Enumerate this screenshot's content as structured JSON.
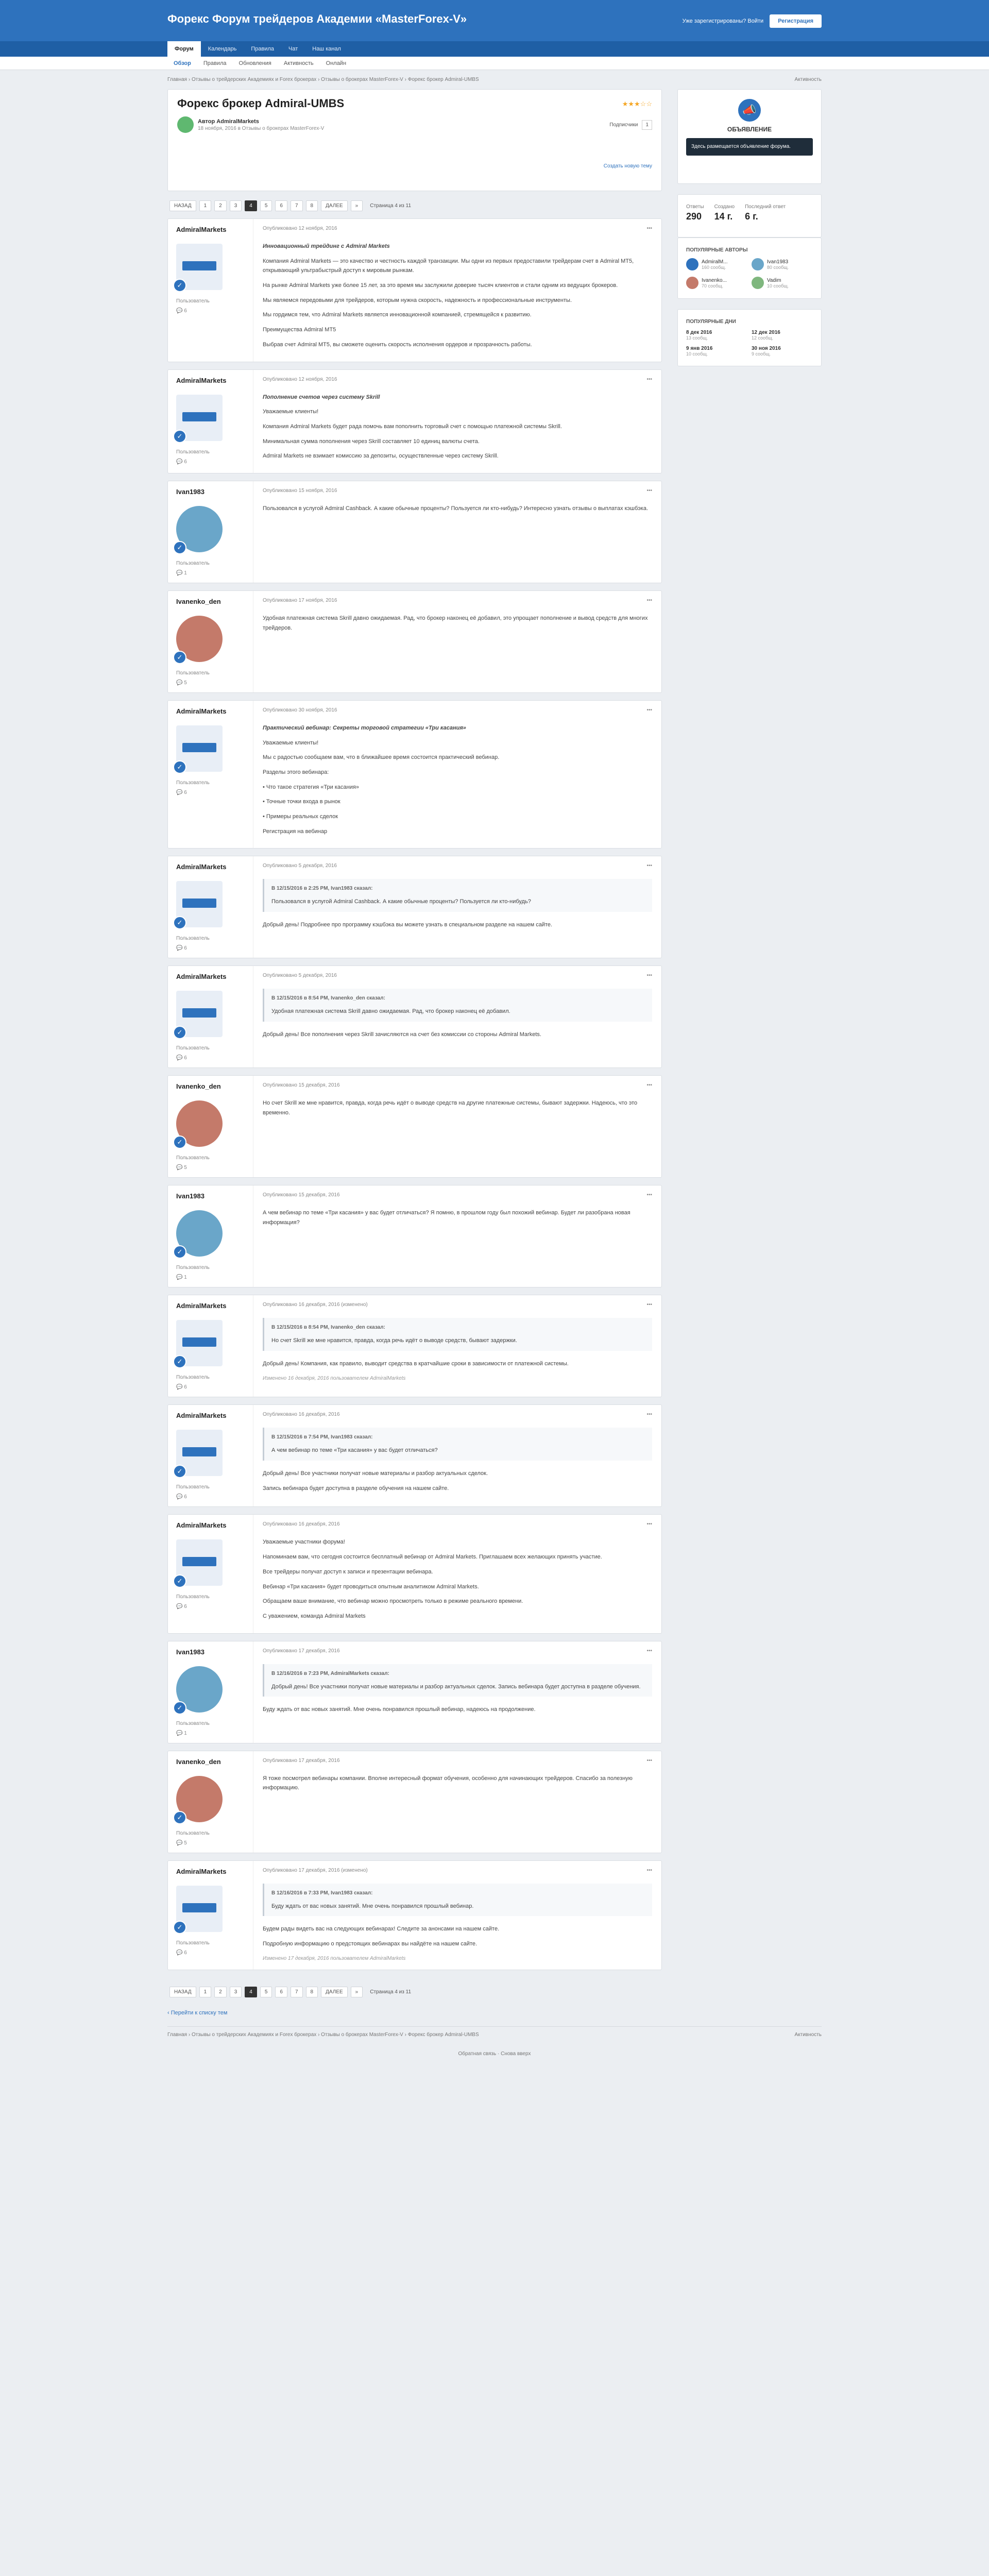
{
  "header": {
    "logo": "Форекс Форум трейдеров Академии «MasterForex-V»",
    "have_account": "Уже зарегистрированы? Войти",
    "register": "Регистрация",
    "nav": [
      "Форум",
      "Календарь",
      "Правила",
      "Чат",
      "Наш канал"
    ],
    "subnav": [
      "Обзор",
      "Правила",
      "Обновления",
      "Активность",
      "Онлайн"
    ]
  },
  "crumbs": {
    "path": "Главная › Отзывы о трейдерских Академиях и Forex брокерах › Отзывы о брокерах MasterForex-V › Форекс брокер Admiral-UMBS",
    "activity": "Активность"
  },
  "topic": {
    "title": "Форекс брокер Admiral-UMBS",
    "rating": "★★★☆☆",
    "author": "Автор AdmiralMarkets",
    "date": "18 ноября, 2016 в Отзывы о брокерах MasterForex-V",
    "subscribe_label": "Подписчики",
    "subscribe_count": "1",
    "create_new": "Создать новую тему"
  },
  "pager": {
    "prev": "НАЗАД",
    "pages": [
      "1",
      "2",
      "3",
      "4",
      "5",
      "6",
      "7",
      "8"
    ],
    "current": "4",
    "next": "ДАЛЕЕ",
    "last": "»",
    "info": "Страница 4 из 11"
  },
  "posts": [
    {
      "name": "AdmiralMarkets",
      "role": "Пользователь",
      "count": "6",
      "date": "Опубликовано 12 ноября, 2016",
      "paras": [
        "Инновационный трейдинг с Admiral Markets",
        "Компания Admiral Markets — это качество и честность каждой транзакции. Мы одни из первых предоставили трейдерам счет в Admiral MT5, открывающий ультрабыстрый доступ к мировым рынкам.",
        "На рынке Admiral Markets уже более 15 лет, за это время мы заслужили доверие тысяч клиентов и стали одним из ведущих брокеров.",
        "Мы являемся передовыми для трейдеров, которым нужна скорость, надежность и профессиональные инструменты.",
        "Мы гордимся тем, что Admiral Markets является инновационной компанией, стремящейся к развитию.",
        "Преимущества Admiral MT5",
        "Выбрав счет Admiral MT5, вы сможете оценить скорость исполнения ордеров и прозрачность работы."
      ]
    },
    {
      "name": "AdmiralMarkets",
      "role": "Пользователь",
      "count": "6",
      "date": "Опубликовано 12 ноября, 2016",
      "paras": [
        "Пополнение счетов через систему Skrill",
        "Уважаемые клиенты!",
        "Компания Admiral Markets будет рада помочь вам пополнить торговый счет с помощью платежной системы Skrill.",
        "Минимальная сумма пополнения через Skrill составляет 10 единиц валюты счета.",
        "Admiral Markets не взимает комиссию за депозиты, осуществленные через систему Skrill."
      ]
    },
    {
      "name": "Ivan1983",
      "role": "Пользователь",
      "count": "1",
      "date": "Опубликовано 15 ноября, 2016",
      "paras": [
        "Пользовался в услугой Admiral Cashback. А какие обычные проценты? Пользуется ли кто-нибудь? Интересно узнать отзывы о выплатах кэшбэка."
      ]
    },
    {
      "name": "Ivanenko_den",
      "role": "Пользователь",
      "count": "5",
      "date": "Опубликовано 17 ноября, 2016",
      "paras": [
        "Удобная платежная система Skrill давно ожидаемая. Рад, что брокер наконец её добавил, это упрощает пополнение и вывод средств для многих трейдеров."
      ]
    },
    {
      "name": "AdmiralMarkets",
      "role": "Пользователь",
      "count": "6",
      "date": "Опубликовано 30 ноября, 2016",
      "paras": [
        "Практический вебинар: Секреты торговой стратегии «Три касания»",
        "Уважаемые клиенты!",
        "Мы с радостью сообщаем вам, что в ближайшее время состоится практический вебинар.",
        "Разделы этого вебинара:",
        "• Что такое стратегия «Три касания»",
        "• Точные точки входа в рынок",
        "• Примеры реальных сделок",
        "Регистрация на вебинар"
      ]
    },
    {
      "name": "AdmiralMarkets",
      "role": "Пользователь",
      "count": "6",
      "date": "Опубликовано 5 декабря, 2016",
      "quote_head": "В 12/15/2016 в 2:25 PM, Ivan1983 сказал:",
      "quote": "Пользовался в услугой Admiral Cashback. А какие обычные проценты? Пользуется ли кто-нибудь?",
      "paras": [
        "Добрый день! Подробнее про программу кэшбэка вы можете узнать в специальном разделе на нашем сайте."
      ]
    },
    {
      "name": "AdmiralMarkets",
      "role": "Пользователь",
      "count": "6",
      "date": "Опубликовано 5 декабря, 2016",
      "quote_head": "В 12/15/2016 в 8:54 PM, Ivanenko_den сказал:",
      "quote": "Удобная платежная система Skrill давно ожидаемая. Рад, что брокер наконец её добавил.",
      "paras": [
        "Добрый день! Все пополнения через Skrill зачисляются на счет без комиссии со стороны Admiral Markets."
      ]
    },
    {
      "name": "Ivanenko_den",
      "role": "Пользователь",
      "count": "5",
      "date": "Опубликовано 15 декабря, 2016",
      "paras": [
        "Но счет Skrill же мне нравится, правда, когда речь идёт о выводе средств на другие платежные системы, бывают задержки. Надеюсь, что это временно."
      ]
    },
    {
      "name": "Ivan1983",
      "role": "Пользователь",
      "count": "1",
      "date": "Опубликовано 15 декабря, 2016",
      "paras": [
        "А чем вебинар по теме «Три касания» у вас будет отличаться? Я помню, в прошлом году был похожий вебинар. Будет ли разобрана новая информация?"
      ]
    },
    {
      "name": "AdmiralMarkets",
      "role": "Пользователь",
      "count": "6",
      "date": "Опубликовано 16 декабря, 2016 (изменено)",
      "quote_head": "В 12/15/2016 в 8:54 PM, Ivanenko_den сказал:",
      "quote": "Но счет Skrill же мне нравится, правда, когда речь идёт о выводе средств, бывают задержки.",
      "paras": [
        "Добрый день! Компания, как правило, выводит средства в кратчайшие сроки в зависимости от платежной системы."
      ],
      "edit": "Изменено 16 декабря, 2016 пользователем AdmiralMarkets"
    },
    {
      "name": "AdmiralMarkets",
      "role": "Пользователь",
      "count": "6",
      "date": "Опубликовано 16 декабря, 2016",
      "quote_head": "В 12/15/2016 в 7:54 PM, Ivan1983 сказал:",
      "quote": "А чем вебинар по теме «Три касания» у вас будет отличаться?",
      "paras": [
        "Добрый день! Все участники получат новые материалы и разбор актуальных сделок.",
        "Запись вебинара будет доступна в разделе обучения на нашем сайте."
      ]
    },
    {
      "name": "AdmiralMarkets",
      "role": "Пользователь",
      "count": "6",
      "date": "Опубликовано 16 декабря, 2016",
      "paras": [
        "Уважаемые участники форума!",
        "Напоминаем вам, что сегодня состоится бесплатный вебинар от Admiral Markets. Приглашаем всех желающих принять участие.",
        "Все трейдеры получат доступ к записи и презентации вебинара.",
        "Вебинар «Три касания» будет проводиться опытным аналитиком Admiral Markets.",
        "Обращаем ваше внимание, что вебинар можно просмотреть только в режиме реального времени.",
        "С уважением, команда Admiral Markets"
      ]
    },
    {
      "name": "Ivan1983",
      "role": "Пользователь",
      "count": "1",
      "date": "Опубликовано 17 декабря, 2016",
      "quote_head": "В 12/16/2016 в 7:23 PM, AdmiralMarkets сказал:",
      "quote": "Добрый день! Все участники получат новые материалы и разбор актуальных сделок. Запись вебинара будет доступна в разделе обучения.",
      "paras": [
        "Буду ждать от вас новых занятий. Мне очень понравился прошлый вебинар, надеюсь на продолжение."
      ]
    },
    {
      "name": "Ivanenko_den",
      "role": "Пользователь",
      "count": "5",
      "date": "Опубликовано 17 декабря, 2016",
      "paras": [
        "Я тоже посмотрел вебинары компании. Вполне интересный формат обучения, особенно для начинающих трейдеров. Спасибо за полезную информацию."
      ]
    },
    {
      "name": "AdmiralMarkets",
      "role": "Пользователь",
      "count": "6",
      "date": "Опубликовано 17 декабря, 2016 (изменено)",
      "quote_head": "В 12/16/2016 в 7:33 PM, Ivan1983 сказал:",
      "quote": "Буду ждать от вас новых занятий. Мне очень понравился прошлый вебинар.",
      "paras": [
        "Будем рады видеть вас на следующих вебинарах! Следите за анонсами на нашем сайте.",
        "Подробную информацию о предстоящих вебинарах вы найдёте на нашем сайте."
      ],
      "edit": "Изменено 17 декабря, 2016 пользователем AdmiralMarkets"
    }
  ],
  "sidebar": {
    "ad_title": "ОБЪЯВЛЕНИЕ",
    "ad_text": "Здесь размещается объявление форума.",
    "stats": [
      {
        "label": "Ответы",
        "value": "290"
      },
      {
        "label": "Создано",
        "value": "14 г."
      },
      {
        "label": "Последний ответ",
        "value": "6 г."
      }
    ],
    "popular_title": "Популярные авторы",
    "popular": [
      {
        "name": "AdmiralM...",
        "sub": "160 сообщ."
      },
      {
        "name": "Ivan1983",
        "sub": "80 сообщ."
      },
      {
        "name": "Ivanenko...",
        "sub": "70 сообщ."
      },
      {
        "name": "Vadim",
        "sub": "10 сообщ."
      }
    ],
    "days_title": "Популярные дни",
    "days": [
      {
        "date": "8 дек 2016",
        "count": "13 сообщ."
      },
      {
        "date": "12 дек 2016",
        "count": "12 сообщ."
      },
      {
        "date": "9 янв 2016",
        "count": "10 сообщ."
      },
      {
        "date": "30 ноя 2016",
        "count": "9 сообщ."
      }
    ]
  },
  "bottom": {
    "back": "‹ Перейти к списку тем",
    "footcrumbs": "Главная › Отзывы о трейдерских Академиях и Forex брокерах › Отзывы о брокерах MasterForex-V › Форекс брокер Admiral-UMBS",
    "activity": "Активность",
    "footer": "Обратная связь · Снова вверх"
  },
  "colors": {
    "brand": "#2e72bd",
    "brand_dark": "#1f5fa5"
  }
}
